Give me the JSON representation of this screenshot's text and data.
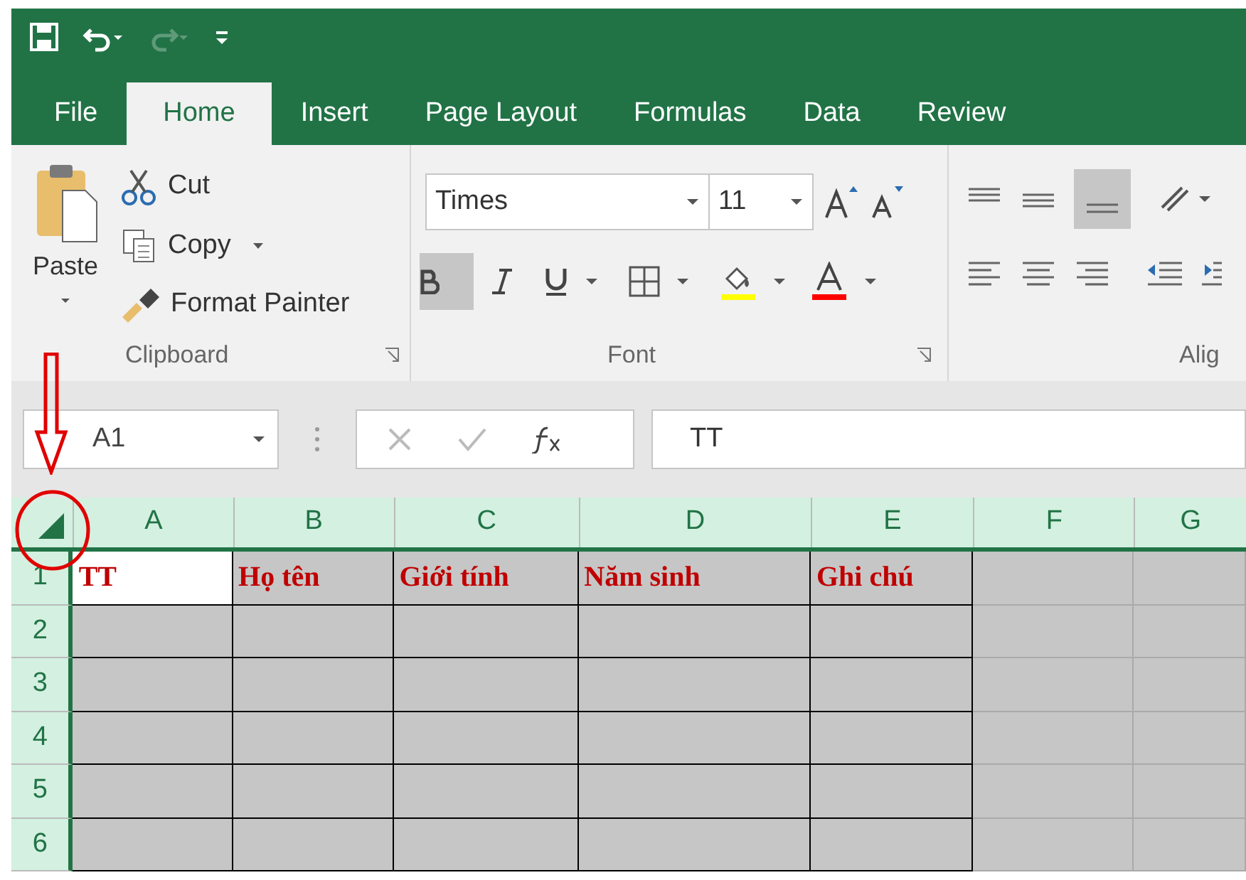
{
  "quick_access": [
    {
      "kind": "save",
      "disabled": false
    },
    {
      "kind": "undo",
      "disabled": false
    },
    {
      "kind": "redo",
      "disabled": true
    },
    {
      "kind": "customize",
      "disabled": false
    }
  ],
  "tabs": [
    {
      "label": "File",
      "selected": false
    },
    {
      "label": "Home",
      "selected": true
    },
    {
      "label": "Insert",
      "selected": false
    },
    {
      "label": "Page Layout",
      "selected": false
    },
    {
      "label": "Formulas",
      "selected": false
    },
    {
      "label": "Data",
      "selected": false
    },
    {
      "label": "Review",
      "selected": false
    }
  ],
  "clipboard": {
    "paste": "Paste",
    "cut": "Cut",
    "copy": "Copy",
    "format_painter": "Format Painter",
    "label": "Clipboard"
  },
  "font": {
    "name": "Times",
    "size": "11",
    "bold": true,
    "label": "Font"
  },
  "alignment": {
    "label": "Alig",
    "bottom_align": true
  },
  "formula_bar": {
    "name_box": "A1",
    "value": "TT"
  },
  "sheet": {
    "all_selected": true,
    "columns": [
      "A",
      "B",
      "C",
      "D",
      "E",
      "F",
      "G"
    ],
    "rows": [
      {
        "number": "1",
        "cells": [
          {
            "text": "TT",
            "active": true
          },
          {
            "text": "Họ tên",
            "active": false
          },
          {
            "text": "Giới tính",
            "active": false
          },
          {
            "text": "Năm sinh",
            "active": false
          },
          {
            "text": "Ghi chú",
            "active": false
          }
        ]
      },
      {
        "number": "2",
        "cells": []
      },
      {
        "number": "3",
        "cells": []
      },
      {
        "number": "4",
        "cells": []
      },
      {
        "number": "5",
        "cells": []
      },
      {
        "number": "6",
        "cells": []
      }
    ]
  },
  "annotation": {
    "arrow": true,
    "circle": true
  }
}
